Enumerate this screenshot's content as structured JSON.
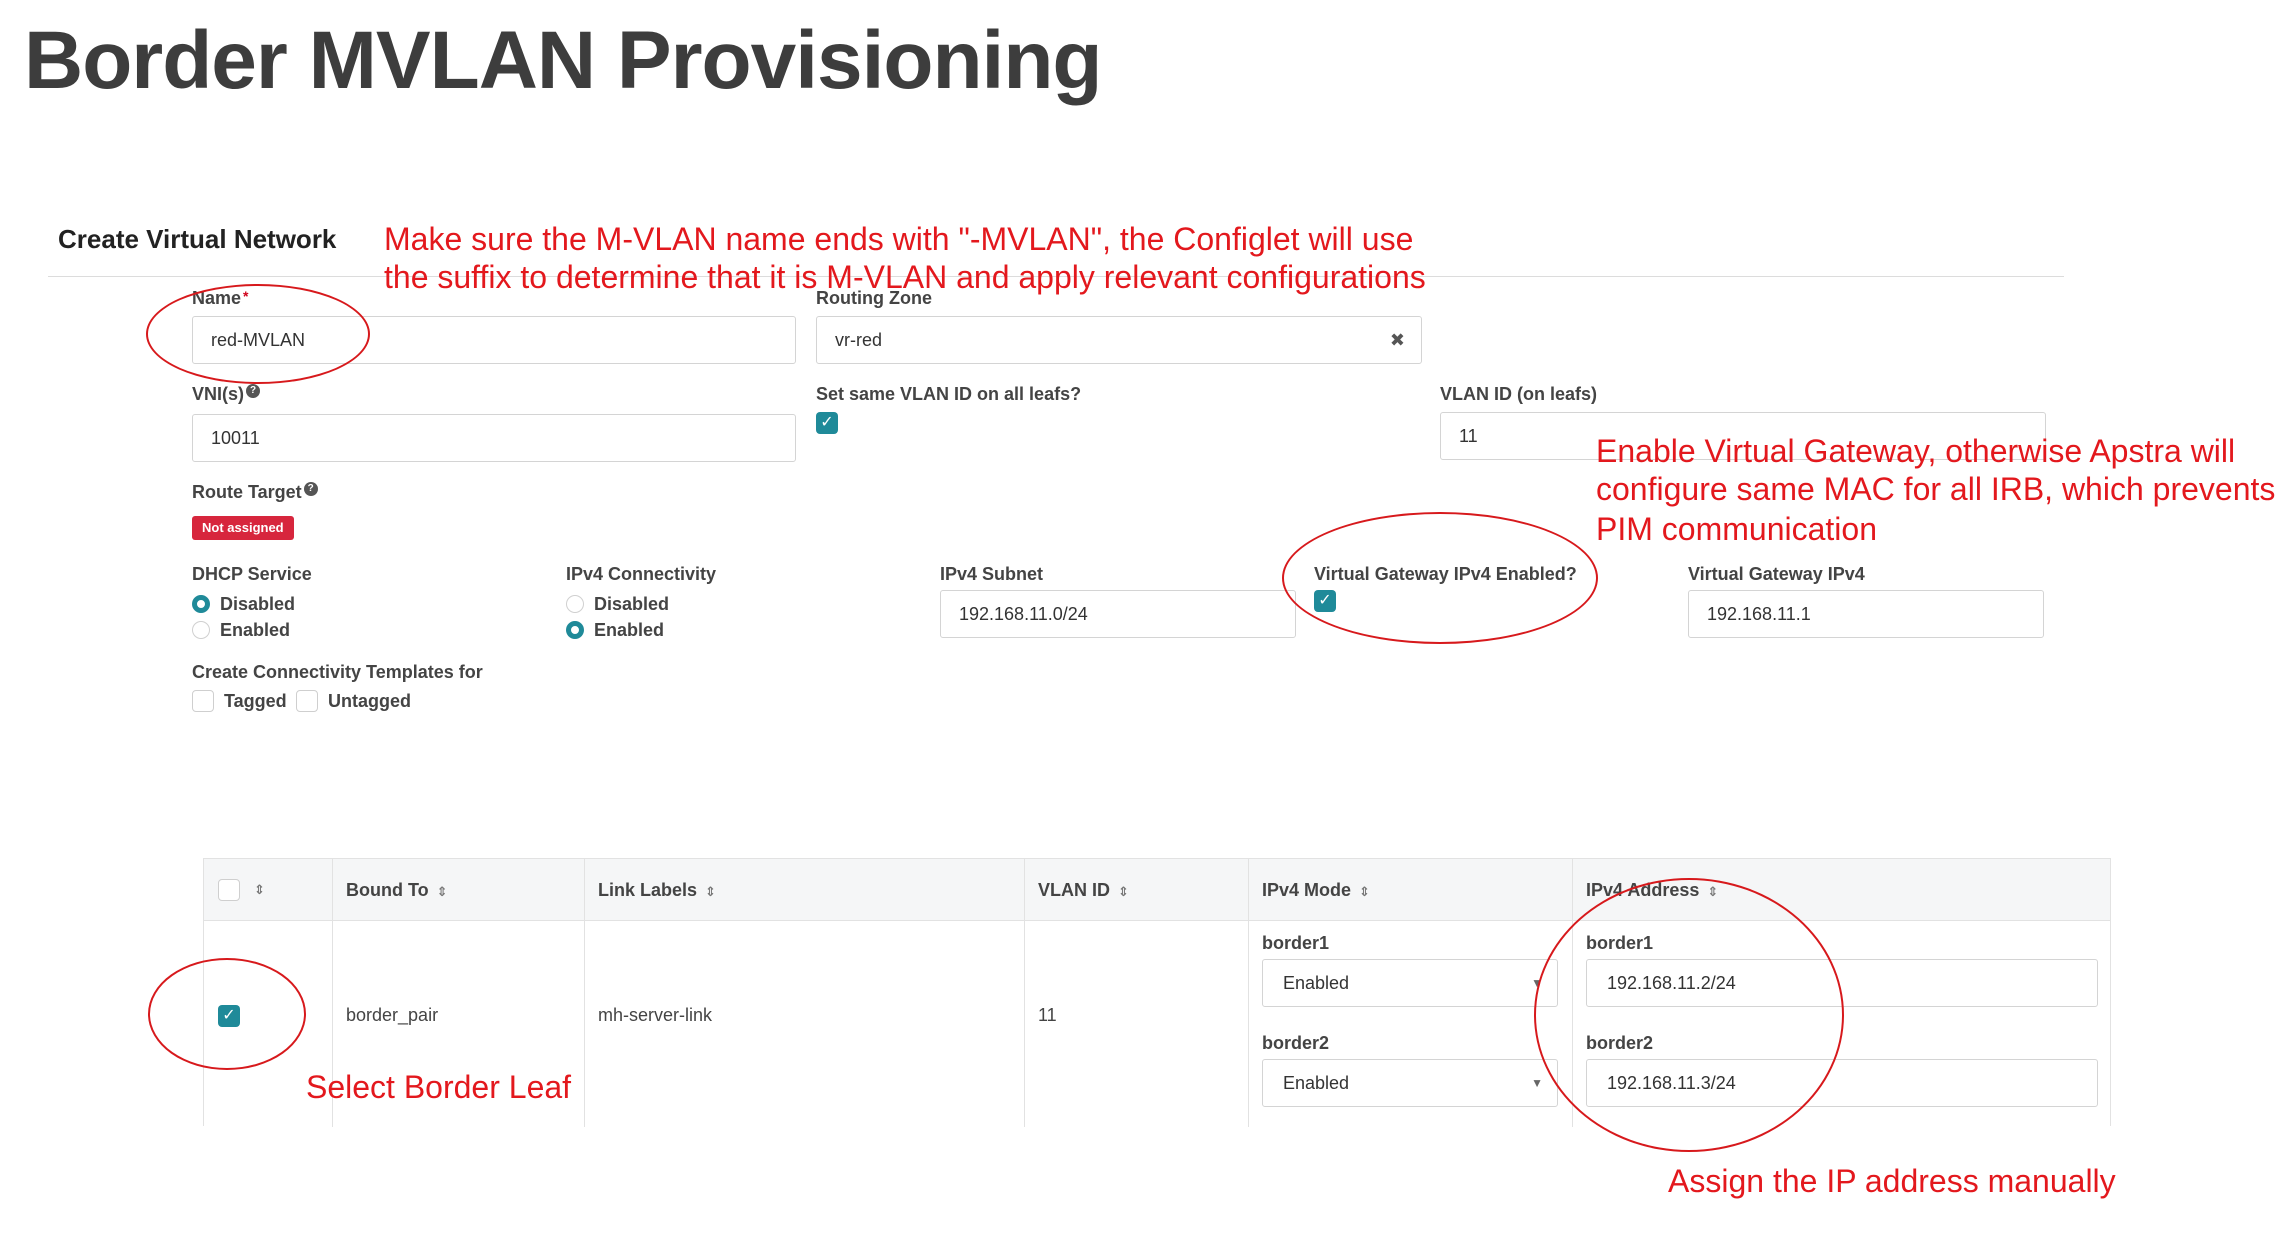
{
  "slide": {
    "title": "Border MVLAN Provisioning"
  },
  "form": {
    "title": "Create Virtual Network",
    "name": {
      "label": "Name",
      "required_mark": "*",
      "value": "red-MVLAN"
    },
    "routing_zone": {
      "label": "Routing Zone",
      "value": "vr-red",
      "clear": "✖"
    },
    "vni": {
      "label": "VNI(s)",
      "value": "10011"
    },
    "same_vlan": {
      "label": "Set same VLAN ID on all leafs?",
      "checked": true
    },
    "vlan_id": {
      "label": "VLAN ID (on leafs)",
      "value": "11"
    },
    "route_target": {
      "label": "Route Target",
      "badge": "Not assigned"
    },
    "dhcp": {
      "label": "DHCP Service",
      "options": [
        "Disabled",
        "Enabled"
      ],
      "selected": "Disabled"
    },
    "ipv4_conn": {
      "label": "IPv4 Connectivity",
      "options": [
        "Disabled",
        "Enabled"
      ],
      "selected": "Enabled"
    },
    "ipv4_subnet": {
      "label": "IPv4 Subnet",
      "value": "192.168.11.0/24"
    },
    "vgw_enabled": {
      "label": "Virtual Gateway IPv4 Enabled?",
      "checked": true
    },
    "vgw_ipv4": {
      "label": "Virtual Gateway IPv4",
      "value": "192.168.11.1"
    },
    "ct": {
      "label": "Create Connectivity Templates for",
      "options": [
        "Tagged",
        "Untagged"
      ]
    }
  },
  "table": {
    "headers": [
      "Bound To",
      "Link Labels",
      "VLAN ID",
      "IPv4 Mode",
      "IPv4 Address"
    ],
    "row": {
      "checked": true,
      "bound_to": "border_pair",
      "link_labels": "mh-server-link",
      "vlan_id": "11",
      "members": [
        {
          "name": "border1",
          "mode": "Enabled",
          "address": "192.168.11.2/24"
        },
        {
          "name": "border2",
          "mode": "Enabled",
          "address": "192.168.11.3/24"
        }
      ]
    }
  },
  "annotations": {
    "mvlan_line1": "Make sure the M-VLAN name ends with \"-MVLAN\", the Configlet will use",
    "mvlan_line2": "the suffix to determine that it is M-VLAN and apply relevant configurations",
    "vgw_line1": "Enable Virtual Gateway, otherwise Apstra will",
    "vgw_line2": "configure same MAC for all IRB, which prevents",
    "vgw_line3": "PIM communication",
    "select_leaf": "Select Border Leaf",
    "assign_ip": "Assign the IP address manually"
  },
  "icons": {
    "check": "checkmark-icon",
    "sort": "sort-icon",
    "help": "help-icon",
    "caret": "chevron-down-icon"
  },
  "colors": {
    "accent": "#1f8a99",
    "annotation": "#e3181d",
    "badge": "#d7263d"
  }
}
